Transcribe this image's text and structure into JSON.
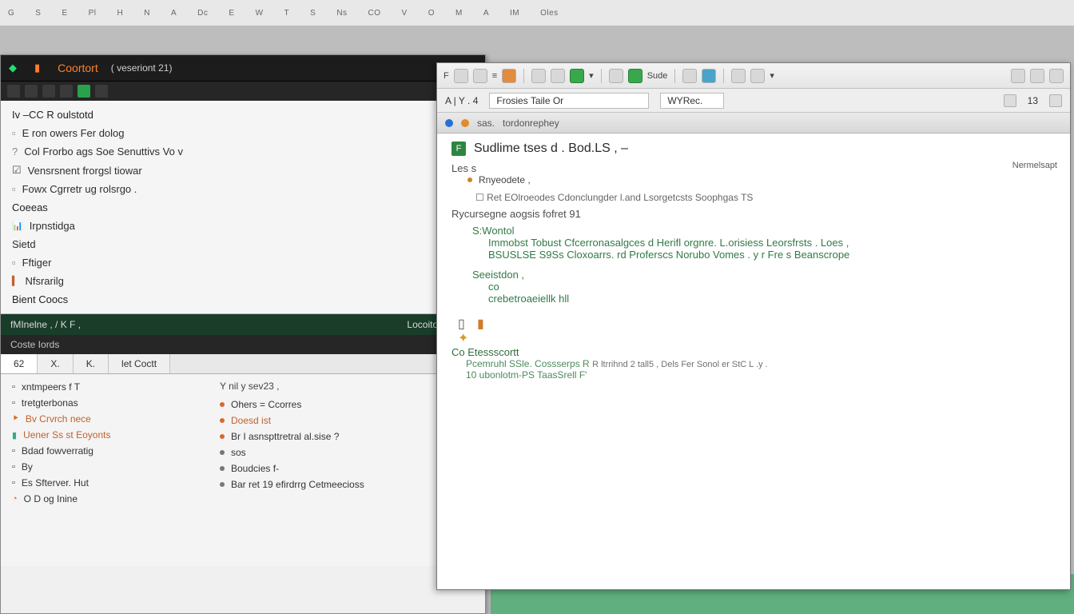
{
  "top_menu": [
    "G",
    "S",
    "E",
    "Pl",
    "H",
    "N",
    "A",
    "Dc",
    "E",
    "W",
    "T",
    "S",
    "Ns",
    "CO",
    "V",
    "O",
    "M",
    "A",
    "IM",
    "Oles"
  ],
  "leftwin": {
    "title": "Coortort",
    "subtitle": "( veseriont  21)",
    "tree": [
      {
        "label": "Iv    –CC  R   oulstotd",
        "type": "header"
      },
      {
        "label": "E ron owers  Fer  dolog",
        "type": "box"
      },
      {
        "label": "Col  Frorbo  ags  Soe  Senuttivs  Vo v",
        "type": "q"
      },
      {
        "label": "Vensrsnent  frorgsl  tiowar",
        "type": "chk"
      },
      {
        "label": "Fowx  Cgrretr  ug  rolsrgo .",
        "type": "box"
      },
      {
        "label": "Coeeas",
        "type": "header"
      },
      {
        "label": "Irpnstidga",
        "type": "chart"
      },
      {
        "label": "Sietd",
        "type": "plain"
      },
      {
        "label": "Fftiger",
        "type": "box"
      },
      {
        "label": "Nfsrarilg",
        "type": "plain"
      },
      {
        "label": "Bient  Coocs",
        "type": "header"
      }
    ],
    "panel_header_left": "fMInelne ,  /  K F ,",
    "panel_header_right": "Locoitor!",
    "panel2": "Coste  Iords",
    "tabs": [
      "62",
      "X.",
      "K.",
      "let  Coctt"
    ],
    "colA_header": "",
    "colB_header": "Y   nil y  sev23 ,",
    "colA": [
      {
        "label": "xntmpeers f T",
        "cls": "plain"
      },
      {
        "label": "tretgterbonas",
        "cls": "plain"
      },
      {
        "label": "Bv  Crvrch nece",
        "cls": "link"
      },
      {
        "label": "Uener  Ss st  Eoyonts",
        "cls": "link"
      },
      {
        "label": "Bdad  fowverratig",
        "cls": "plain"
      },
      {
        "label": "By",
        "cls": "plain"
      },
      {
        "label": "Es  Sfterver.    Hut",
        "cls": "plain"
      },
      {
        "label": "O  D og  Inine",
        "cls": "plain"
      }
    ],
    "colB": [
      {
        "label": "Ohers =  Ccorres",
        "b": "o"
      },
      {
        "label": "Doesd     ist",
        "b": "o"
      },
      {
        "label": "Br    I asnspttretral  al.sise ?",
        "b": "o"
      },
      {
        "label": "sos",
        "b": ""
      },
      {
        "label": "Boudcies  f-",
        "b": ""
      },
      {
        "label": "Bar   ret  19 efirdrrg     Cetmeecioss",
        "b": ""
      }
    ]
  },
  "rightwin": {
    "toolbar_label": "Sude",
    "crumb": "A     |  Y . 4",
    "field1": "Frosies  Taile  Or",
    "field2": "WYRec.",
    "addr_host": "sas.",
    "addr_path": "tordonrephey",
    "doc": {
      "title": "Sudlime  tses d .    Bod.LS ,  –",
      "meta_right": "Nermelsapt",
      "s1": "Les  s",
      "s2": "Rnyeodete ,",
      "s3": "Ret   EOlroeodes  Cdonclungder    l.and   Lsorgetcsts  Soophgas TS",
      "s4": "Rycursegne  aogsis  fofret  91",
      "s_sv": "S:Wontol",
      "g1a": "Immobst Tobust  Cfcerronasalgces d  Herifl  orgnre.   L.orisiess  Leorsfrsts .   Loes    ,",
      "g1b": "BSUSLSE  S9Ss   Cloxoarrs.     rd  Proferscs Norubo  Vomes .     y   r Fre  s  Beanscrope",
      "s_se": "Seeistdon  ,",
      "g2a": "co",
      "g2b": "crebetroaeiellk  hll",
      "block_head": "Co  Etessscortt",
      "block_l1": "Pcemruhl SSle.   Cossserps R",
      "block_note": "R ltrrihnd   2 tall5 ,   Dels  Fer   Sonol  er  StC   L .y .",
      "block_l2": "10 ubonlotm-PS   TaasSrell F'"
    }
  }
}
